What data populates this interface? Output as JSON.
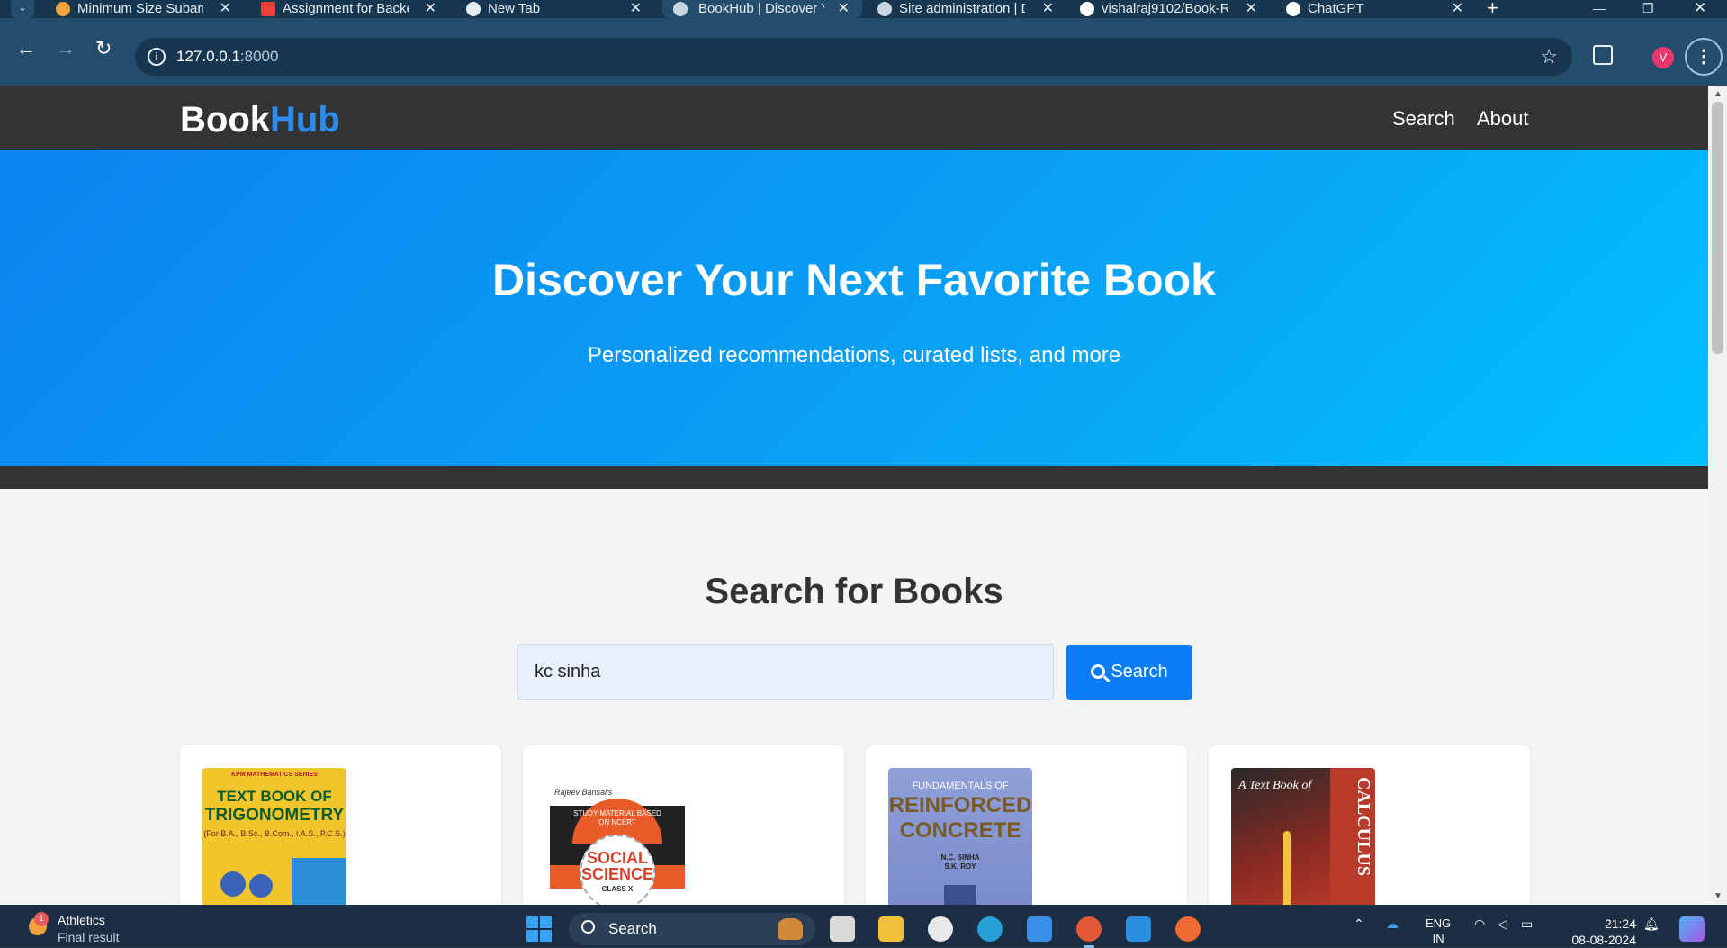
{
  "browser": {
    "tabs": [
      {
        "title": "Minimum Size Subarray",
        "favicon": "bolt-icon"
      },
      {
        "title": "Assignment for Backend",
        "favicon": "gmail-icon"
      },
      {
        "title": "New Tab",
        "favicon": "chrome-icon"
      },
      {
        "title": "BookHub | Discover Your",
        "favicon": "globe-icon",
        "active": true
      },
      {
        "title": "Site administration | Django",
        "favicon": "globe-icon"
      },
      {
        "title": "vishalraj9102/Book-R",
        "favicon": "github-icon"
      },
      {
        "title": "ChatGPT",
        "favicon": "openai-icon"
      }
    ],
    "new_tab": "+",
    "url_host": "127.0.0.1",
    "url_port": ":8000",
    "profile_initial": "V"
  },
  "site": {
    "logo_part1": "Book",
    "logo_part2": "Hub",
    "nav": [
      "Search",
      "About"
    ],
    "hero_title": "Discover Your Next Favorite Book",
    "hero_subtitle": "Personalized recommendations, curated lists, and more",
    "search_title": "Search for Books",
    "search_value": "kc sinha",
    "search_button": "Search",
    "accent": "#0a7cf5"
  },
  "books": [
    {
      "cover": "trig",
      "series": "KPM MATHEMATICS SERIES",
      "title_line1": "TEXT BOOK OF",
      "title_line2": "TRIGONOMETRY",
      "subtitle": "(For B.A., B.Sc., B.Com., I.A.S., P.C.S.)"
    },
    {
      "cover": "sst",
      "brand": "Rajeev Bansal's",
      "banner": "STUDY MATERIAL BASED ON NCERT",
      "title_line1": "SOCIAL",
      "title_line2": "SCIENCE",
      "class": "CLASS X"
    },
    {
      "cover": "rcc",
      "kicker": "FUNDAMENTALS OF",
      "title_line1": "REINFORCED",
      "title_line2": "CONCRETE",
      "author1": "N.C. SINHA",
      "author2": "S.K. ROY"
    },
    {
      "cover": "calc",
      "title_script": "A Text Book of",
      "title_side": "CALCULUS"
    }
  ],
  "taskbar": {
    "widget_title": "Athletics",
    "widget_sub": "Final result",
    "widget_badge": "1",
    "search_label": "Search",
    "lang1": "ENG",
    "lang2": "IN",
    "time": "21:24",
    "date": "08-08-2024"
  }
}
